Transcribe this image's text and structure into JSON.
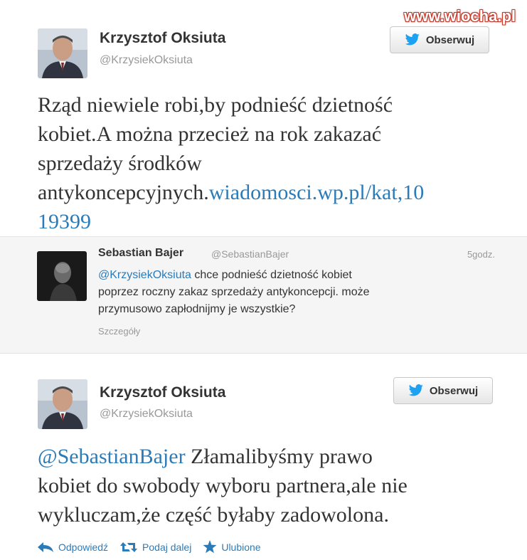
{
  "watermark": "www.wiocha.pl",
  "tweet1": {
    "author_name": "Krzysztof Oksiuta",
    "author_handle": "@KrzysiekOksiuta",
    "follow_label": "Obserwuj",
    "text_lines": [
      "Rząd niewiele robi,by podnieść dzietność",
      "kobiet.A można przecież na rok zakazać",
      "sprzedaży środków"
    ],
    "text_line4_plain": "antykoncepcyjnych.",
    "link_part1": "wiadomosci.wp.pl/kat,10",
    "link_part2": "19399"
  },
  "reply": {
    "author_name": "Sebastian Bajer",
    "author_handle": "@SebastianBajer",
    "time": "5godz.",
    "mention": "@KrzysiekOksiuta",
    "text_line1_rest": " chce podnieść dzietność kobiet",
    "text_line2": "poprzez roczny zakaz sprzedaży antykoncepcji. może",
    "text_line3": "przymusowo zapłodnijmy je wszystkie?",
    "details_label": "Szczegóły"
  },
  "tweet2": {
    "author_name": "Krzysztof Oksiuta",
    "author_handle": "@KrzysiekOksiuta",
    "follow_label": "Obserwuj",
    "mention": "@SebastianBajer",
    "text_line1_rest": " Złamalibyśmy prawo",
    "text_line2": "kobiet do swobody wyboru partnera,ale nie",
    "text_line3": "wykluczam,że część byłaby zadowolona."
  },
  "actions": {
    "reply_label": "Odpowiedź",
    "retweet_label": "Podaj dalej",
    "favorite_label": "Ulubione"
  },
  "colors": {
    "link": "#2b7bb9",
    "twitter_bird": "#1da1f2"
  }
}
